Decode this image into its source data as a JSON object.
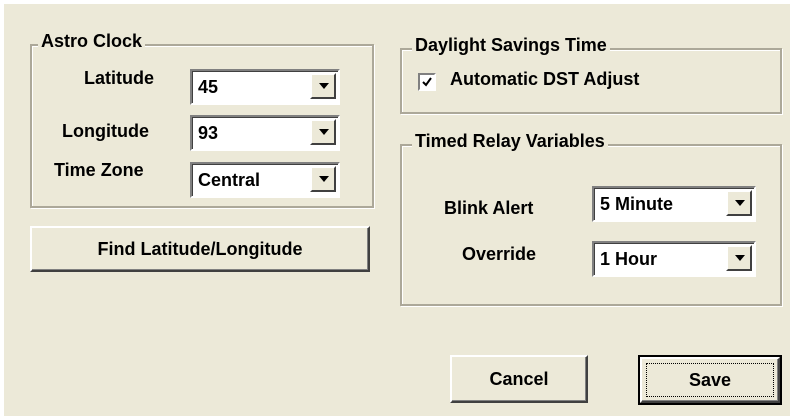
{
  "astro_clock": {
    "title": "Astro Clock",
    "latitude_label": "Latitude",
    "latitude_value": "45",
    "longitude_label": "Longitude",
    "longitude_value": "93",
    "timezone_label": "Time Zone",
    "timezone_value": "Central",
    "find_button_label": "Find Latitude/Longitude"
  },
  "dst": {
    "title": "Daylight Savings Time",
    "auto_adjust_label": "Automatic DST Adjust",
    "auto_adjust_checked": true
  },
  "timed_relay": {
    "title": "Timed Relay Variables",
    "blink_alert_label": "Blink Alert",
    "blink_alert_value": "5 Minute",
    "override_label": "Override",
    "override_value": "1 Hour"
  },
  "actions": {
    "cancel_label": "Cancel",
    "save_label": "Save"
  },
  "icons": {
    "dropdown": "chevron-down-icon",
    "check": "check-icon"
  }
}
